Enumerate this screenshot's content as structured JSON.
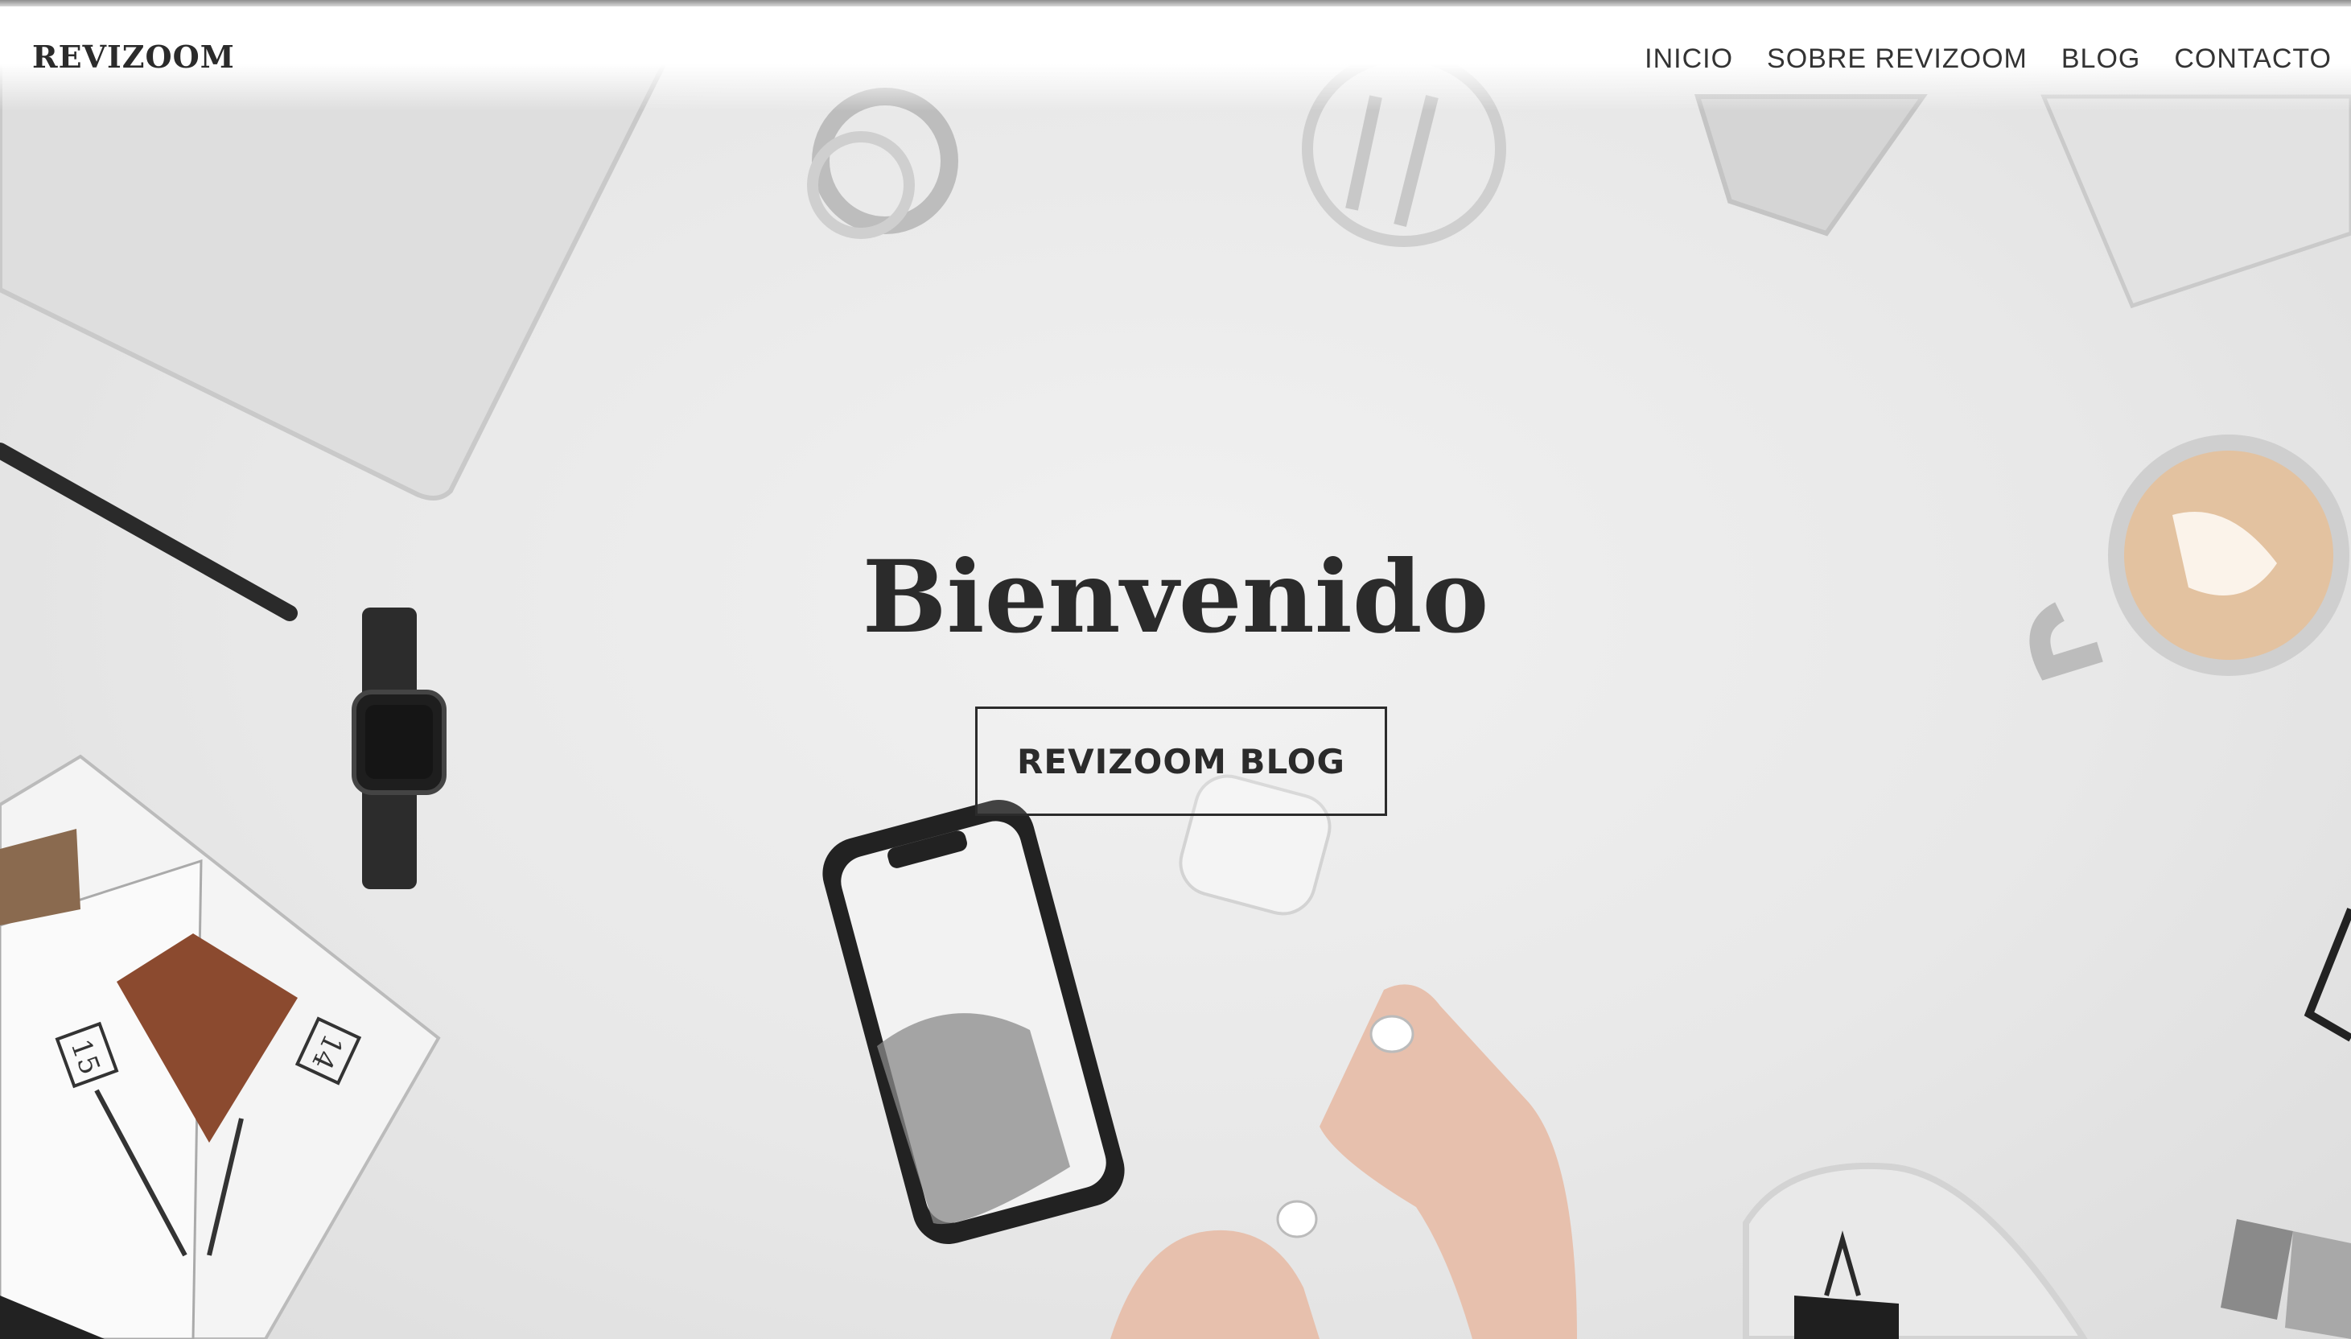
{
  "site": {
    "logo": "REVIZOOM",
    "nav": [
      "INICIO",
      "SOBRE REVIZOOM",
      "BLOG",
      "CONTACTO"
    ]
  },
  "hero": {
    "title": "Bienvenido",
    "cta_label": "REVIZOOM BLOG"
  },
  "magazine": {
    "page_left": "15",
    "page_right": "14"
  },
  "colors": {
    "text": "#2b2b2b",
    "background": "#ececec",
    "header": "#ffffff"
  }
}
